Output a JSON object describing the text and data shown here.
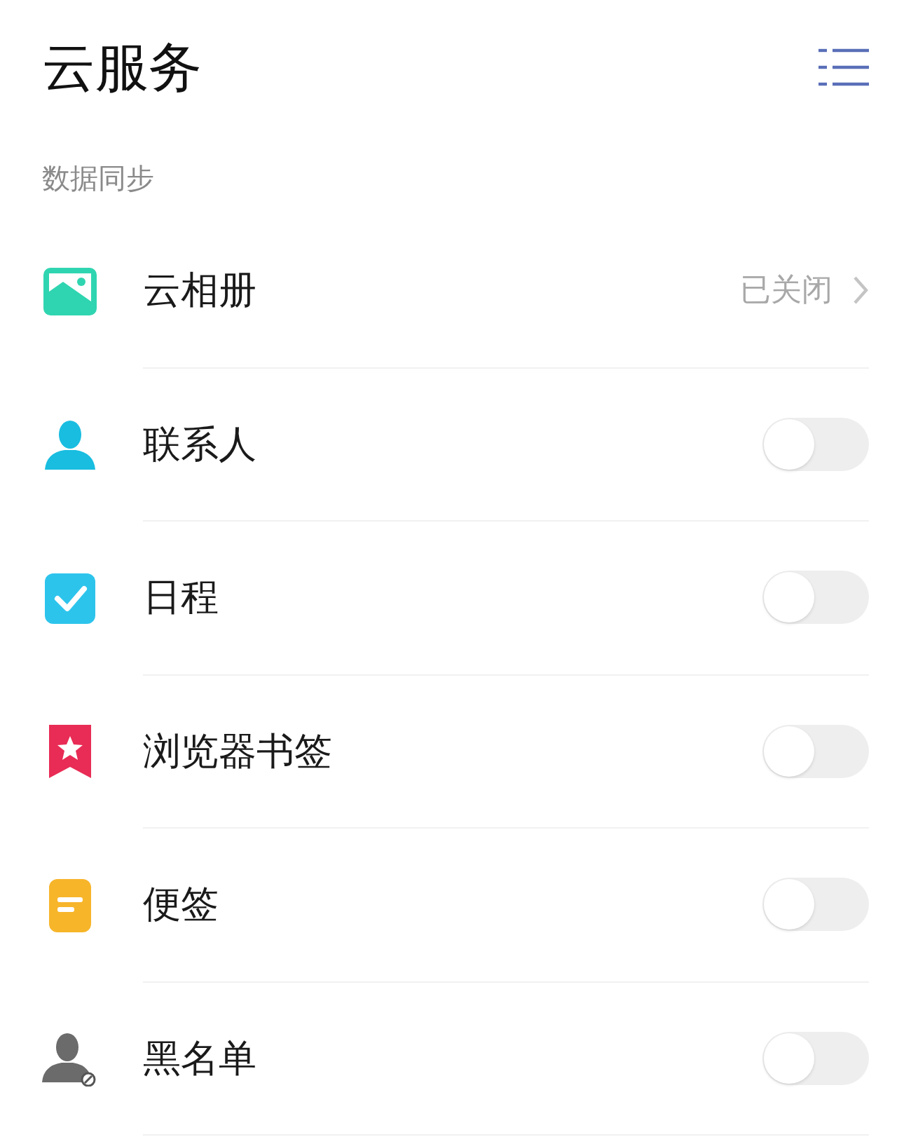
{
  "header": {
    "title": "云服务"
  },
  "section": {
    "label": "数据同步"
  },
  "items": [
    {
      "kind": "link",
      "label": "云相册",
      "value": "已关闭"
    },
    {
      "kind": "toggle",
      "label": "联系人",
      "on": false
    },
    {
      "kind": "toggle",
      "label": "日程",
      "on": false
    },
    {
      "kind": "toggle",
      "label": "浏览器书签",
      "on": false
    },
    {
      "kind": "toggle",
      "label": "便签",
      "on": false
    },
    {
      "kind": "toggle",
      "label": "黑名单",
      "on": false
    }
  ]
}
